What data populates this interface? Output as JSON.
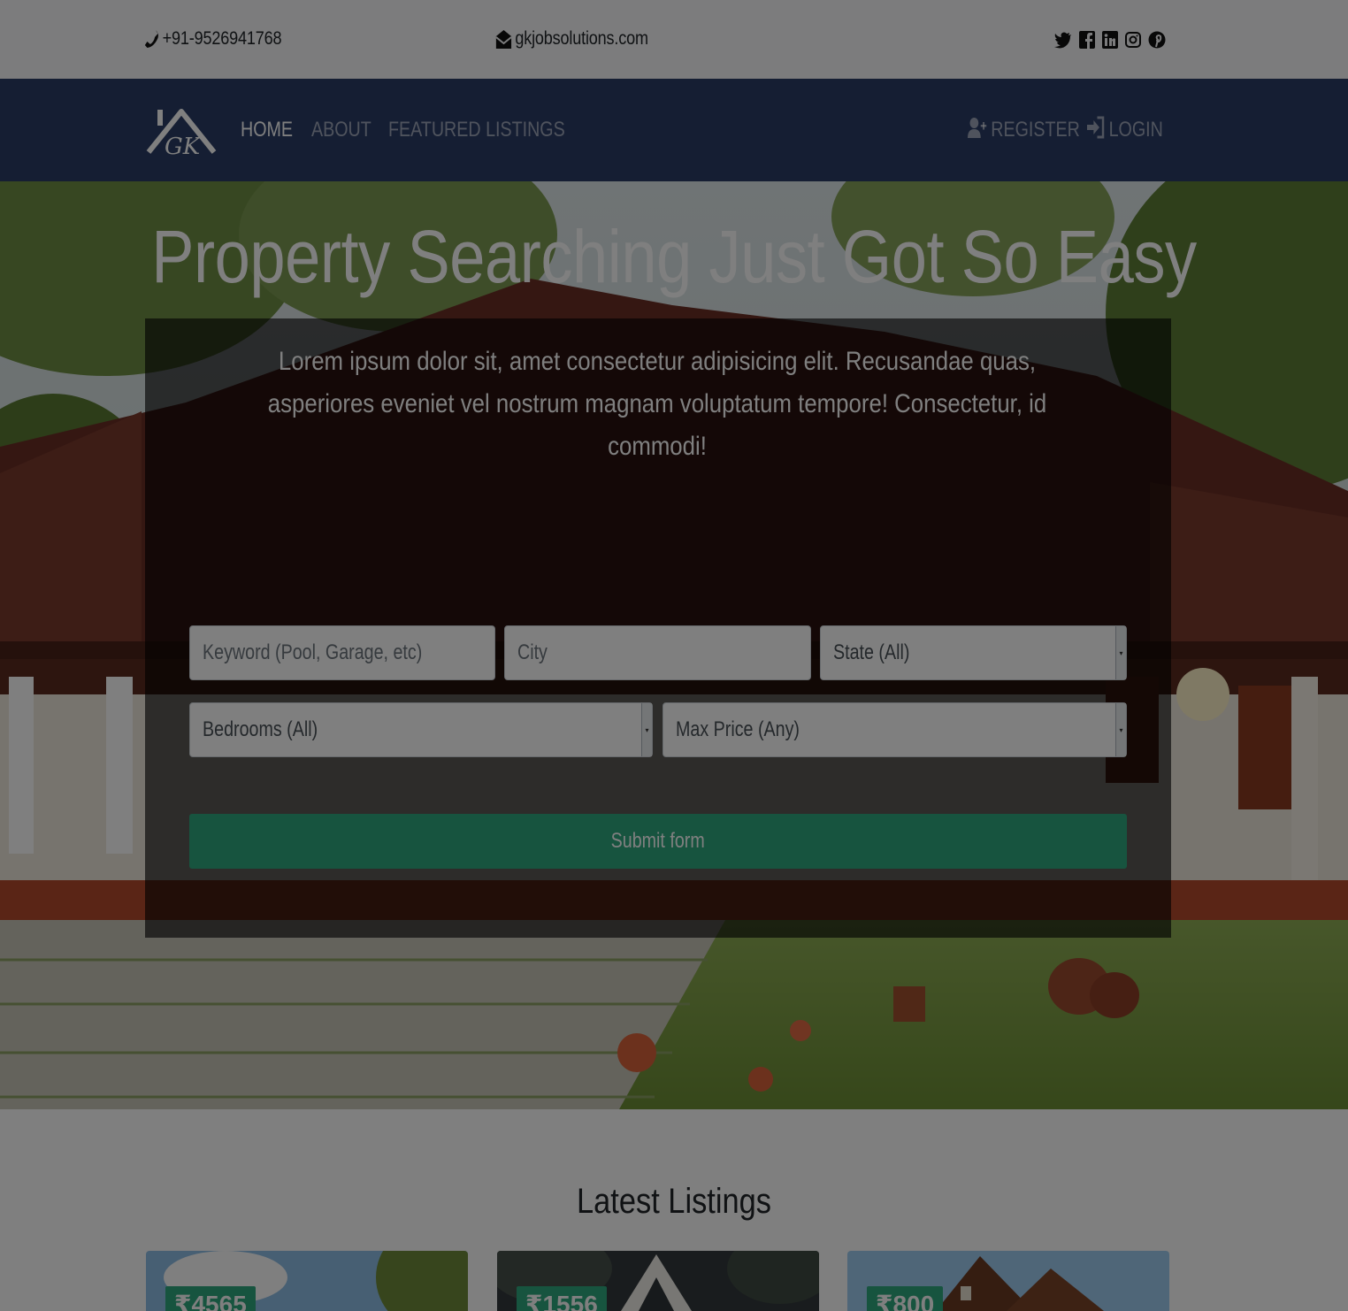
{
  "topbar": {
    "phone": "+91-9526941768",
    "email": "gkjobsolutions.com",
    "social": [
      "twitter-icon",
      "facebook-icon",
      "linkedin-icon",
      "instagram-icon",
      "pinterest-icon"
    ]
  },
  "navbar": {
    "logo_text": "GK",
    "links": [
      {
        "label": "HOME",
        "active": true
      },
      {
        "label": "ABOUT",
        "active": false
      },
      {
        "label": "FEATURED LISTINGS",
        "active": false
      }
    ],
    "register": "REGISTER",
    "login": "LOGIN"
  },
  "hero": {
    "title": "Property Searching Just Got So Easy",
    "lead": "Lorem ipsum dolor sit, amet consectetur adipisicing elit. Recusandae quas, asperiores eveniet vel nostrum magnam voluptatum tempore! Consectetur, id commodi!",
    "form": {
      "keyword_placeholder": "Keyword (Pool, Garage, etc)",
      "city_placeholder": "City",
      "state": "State (All)",
      "bedrooms": "Bedrooms (All)",
      "max_price": "Max Price (Any)",
      "submit": "Submit form"
    }
  },
  "listings": {
    "title": "Latest Listings",
    "prices": [
      "₹4565",
      "₹1556",
      "₹800"
    ]
  },
  "colors": {
    "navbar": "#2a3d66",
    "accent": "#2ea87e",
    "overlay": "rgba(0,0,0,0.5)"
  }
}
